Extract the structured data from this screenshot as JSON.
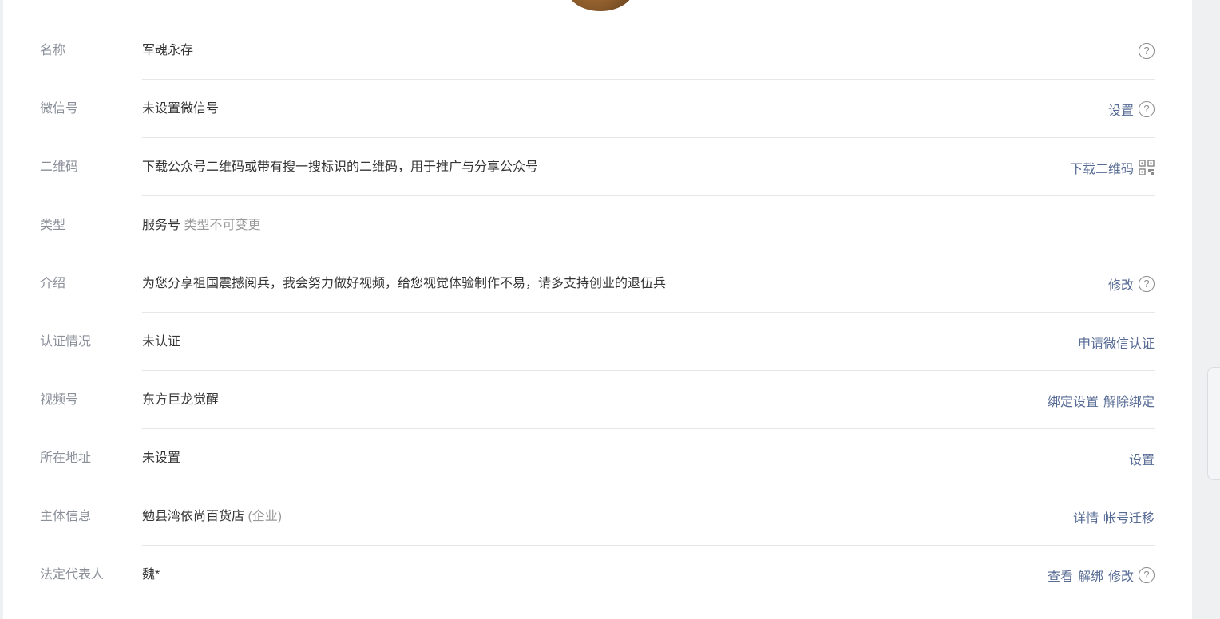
{
  "rows": [
    {
      "label": "名称",
      "value": "军魂永存"
    },
    {
      "label": "微信号",
      "value": "未设置微信号",
      "action": "设置"
    },
    {
      "label": "二维码",
      "value": "下载公众号二维码或带有搜一搜标识的二维码，用于推广与分享公众号",
      "action": "下载二维码"
    },
    {
      "label": "类型",
      "value": "服务号",
      "note": "类型不可变更"
    },
    {
      "label": "介绍",
      "value": "为您分享祖国震撼阅兵，我会努力做好视频，给您视觉体验制作不易，请多支持创业的退伍兵",
      "action": "修改"
    },
    {
      "label": "认证情况",
      "value": "未认证",
      "action": "申请微信认证"
    },
    {
      "label": "视频号",
      "value": "东方巨龙觉醒",
      "action": "绑定设置",
      "action2": "解除绑定"
    },
    {
      "label": "所在地址",
      "value": "未设置",
      "action": "设置"
    },
    {
      "label": "主体信息",
      "value": "勉县湾依尚百货店",
      "note": "(企业)",
      "action": "详情",
      "action2": "帐号迁移"
    },
    {
      "label": "法定代表人",
      "value": "魏*",
      "action": "查看",
      "action2": "解绑",
      "action3": "修改"
    }
  ],
  "help_glyph": "?",
  "colors": {
    "link": "#576b95",
    "label": "#8a8f99",
    "muted": "#9a9a9a",
    "text": "#353535",
    "divider": "#e7e7eb"
  }
}
